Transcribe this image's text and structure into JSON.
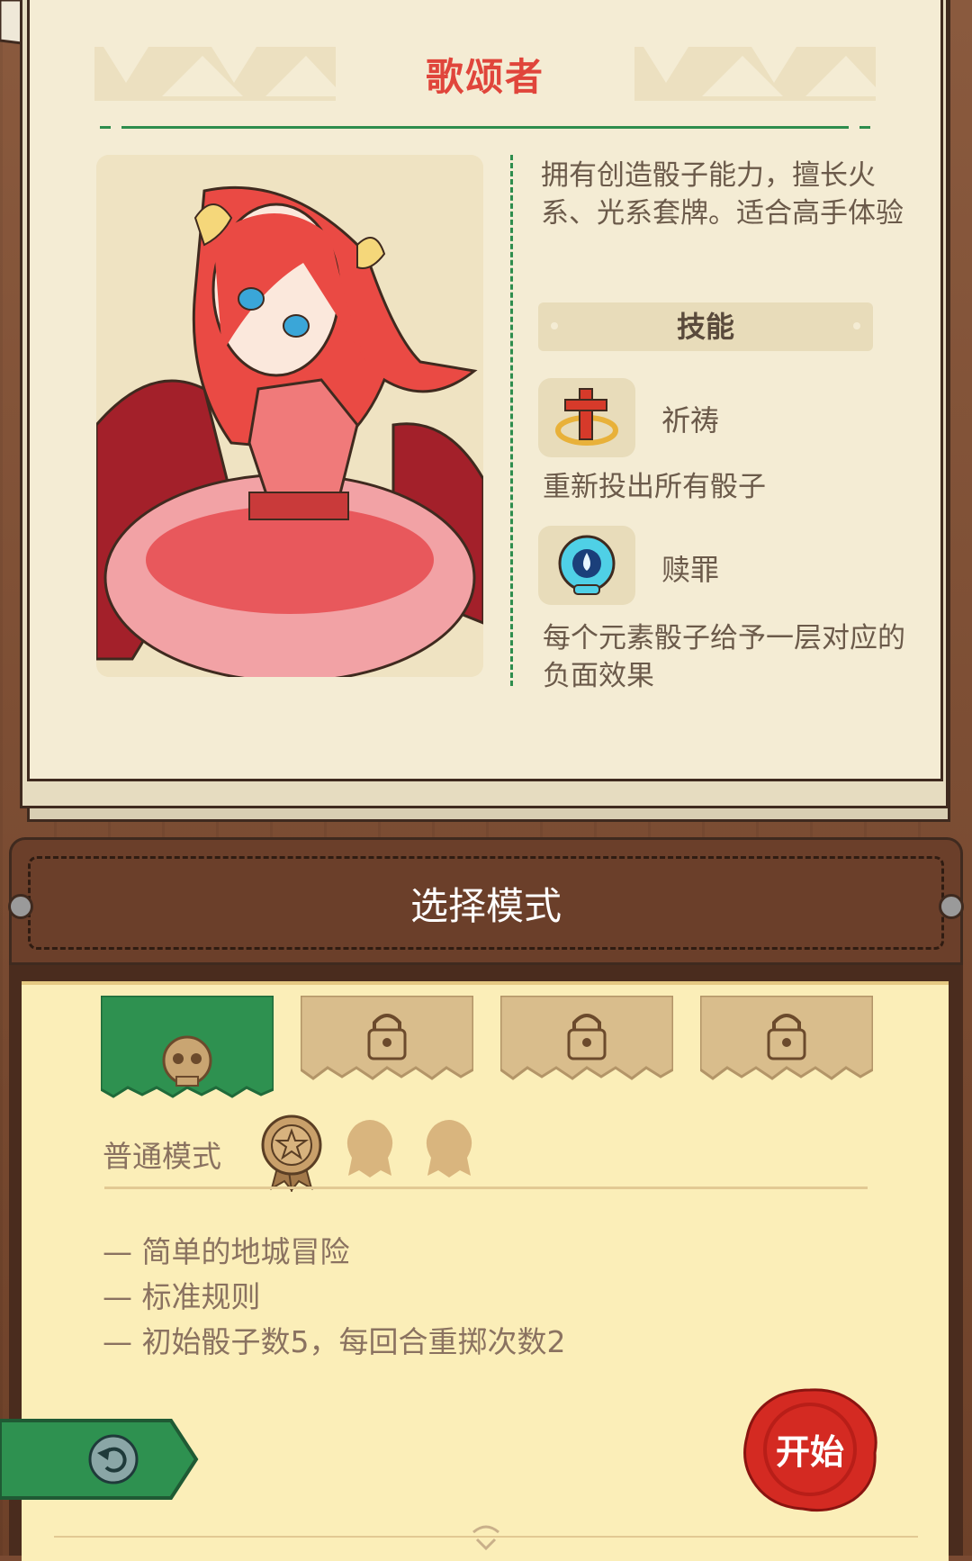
{
  "character": {
    "name": "歌颂者",
    "description": "拥有创造骰子能力，擅长火系、光系套牌。适合高手体验"
  },
  "skills": {
    "header": "技能",
    "items": [
      {
        "name": "祈祷",
        "icon": "cross-icon",
        "description": "重新投出所有骰子"
      },
      {
        "name": "赎罪",
        "icon": "water-skull-icon",
        "description": "每个元素骰子给予一层对应的负面效果"
      }
    ]
  },
  "mode_select": {
    "title": "选择模式",
    "tabs": [
      {
        "icon": "skull-icon",
        "selected": true,
        "locked": false
      },
      {
        "icon": "lock-icon",
        "selected": false,
        "locked": true
      },
      {
        "icon": "lock-icon",
        "selected": false,
        "locked": true
      },
      {
        "icon": "lock-icon",
        "selected": false,
        "locked": true
      }
    ],
    "current_mode": "普通模式",
    "medals": {
      "earned": 1,
      "total": 3
    },
    "rules": [
      "简单的地城冒险",
      "标准规则",
      "初始骰子数5，每回合重掷次数2"
    ]
  },
  "actions": {
    "start_label": "开始",
    "back_icon": "back-arrow-icon"
  },
  "colors": {
    "title_red": "#e0453b",
    "accent_green": "#2e8d4d",
    "seal_red": "#d42a22",
    "wood": "#6b3f2a",
    "paper": "#fbeeb8"
  }
}
